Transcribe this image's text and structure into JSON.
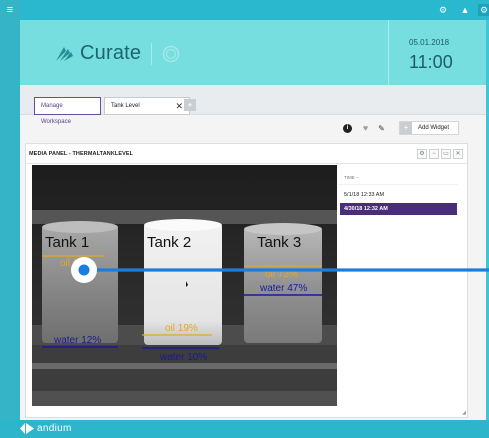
{
  "header": {
    "brand": "Curate",
    "date": "05.01.2018",
    "time": "11:00"
  },
  "tabs": [
    {
      "label": "Manage Workspace"
    },
    {
      "label": "Tank Level",
      "close": "✕"
    }
  ],
  "tab_add": "+",
  "toolbar": {
    "info_icon": "i",
    "add_widget_label": "Add Widget",
    "add_widget_plus": "+"
  },
  "panel": {
    "title": "MEDIA PANEL - THERMALTANKLEVEL",
    "tanks": [
      {
        "name": "Tank 1",
        "oil": "oil 82%",
        "water": "water 12%"
      },
      {
        "name": "Tank 2",
        "oil": "oil 19%",
        "water": "water 10%"
      },
      {
        "name": "Tank 3",
        "oil": "oil 73%",
        "water": "water 47%"
      }
    ],
    "time_header": "TIME -- ",
    "time_rows": [
      "5/1/18 12:33 AM",
      "4/30/18 12:32 AM"
    ]
  },
  "footer": {
    "brand": "andium"
  },
  "colors": {
    "accent": "#3cc6d6",
    "header_bg": "#76dede",
    "selected_row": "#4a2d7a",
    "oil_text": "#e3a91f",
    "water_text": "#1a1a9a",
    "slider": "#1a7ee0"
  }
}
